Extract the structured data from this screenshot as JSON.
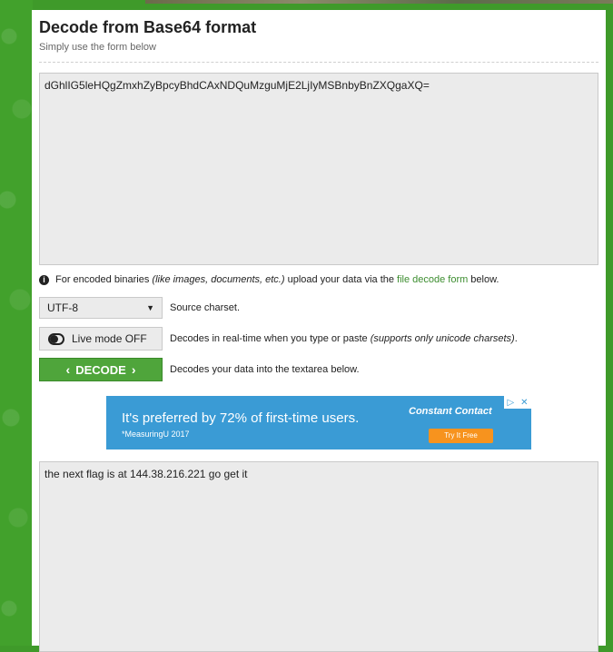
{
  "page": {
    "title": "Decode from Base64 format",
    "subtitle": "Simply use the form below"
  },
  "input": {
    "value": "dGhlIG5leHQgZmxhZyBpcyBhdCAxNDQuMzguMjE2LjIyMSBnbyBnZXQgaXQ="
  },
  "info": {
    "icon": "info-icon",
    "text_before": "For encoded binaries",
    "text_italic": "(like images, documents, etc.)",
    "text_middle": "upload your data via the",
    "link_text": "file decode form",
    "text_after": "below."
  },
  "charset": {
    "selected": "UTF-8",
    "description": "Source charset."
  },
  "live_mode": {
    "label": "Live mode OFF",
    "description": "Decodes in real-time when you type or paste",
    "description_italic": "(supports only unicode charsets)",
    "description_end": "."
  },
  "decode": {
    "label": "DECODE",
    "description": "Decodes your data into the textarea below."
  },
  "ad": {
    "headline": "It's preferred by 72% of first-time users.",
    "source": "*MeasuringU 2017",
    "brand": "Constant Contact",
    "cta": "Try It Free"
  },
  "output": {
    "value": "the next flag is at 144.38.216.221 go get it"
  },
  "colors": {
    "background_green": "#3f9a2a",
    "button_green": "#4fa53b",
    "link_green": "#3c8d2f",
    "ad_blue": "#3a9bd5",
    "ad_cta_orange": "#f7931e"
  }
}
